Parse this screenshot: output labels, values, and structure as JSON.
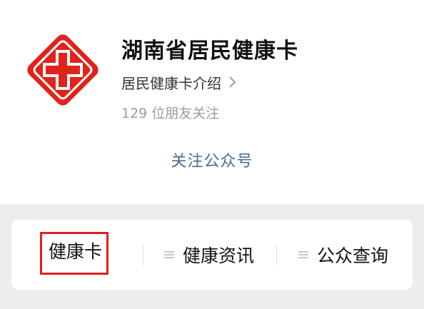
{
  "account": {
    "name": "湖南省居民健康卡",
    "intro_link": "居民健康卡介绍",
    "followers": "129 位朋友关注",
    "follow_button": "关注公众号"
  },
  "logo": {
    "icon": "red-cross-diamond-icon",
    "color": "#e0241b"
  },
  "menu": {
    "items": [
      {
        "label": "健康卡",
        "icon": ""
      },
      {
        "label": "健康资讯",
        "icon": "menu-lines-icon"
      },
      {
        "label": "公众查询",
        "icon": "menu-lines-icon"
      }
    ]
  },
  "colors": {
    "link_blue": "#4a6a94",
    "highlight_red": "#e02020",
    "menu_bg": "#ededed"
  }
}
